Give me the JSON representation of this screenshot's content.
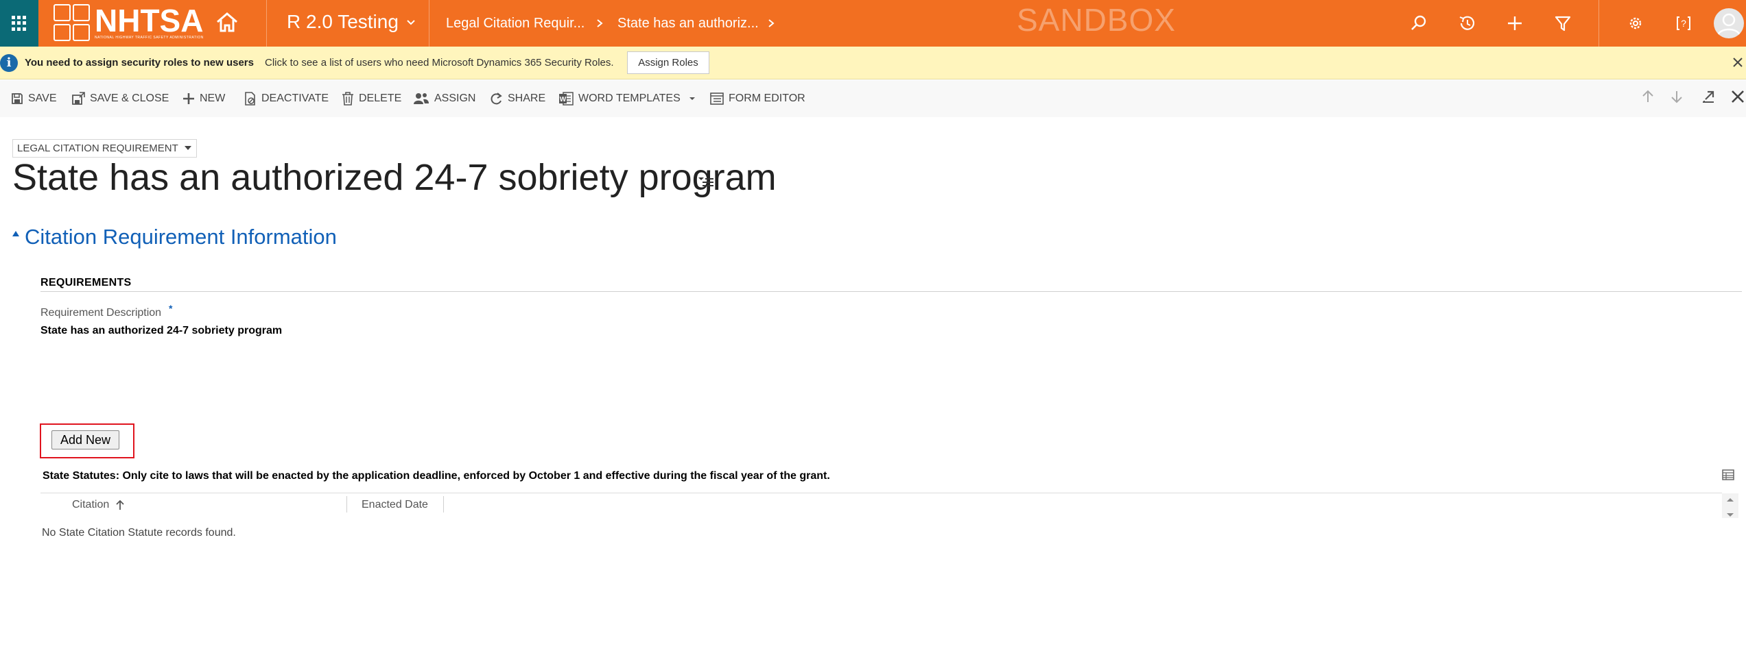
{
  "colors": {
    "nav_bar": "#f26f21",
    "waffle": "#0b6a76",
    "notification": "#fff5bd",
    "section_title": "#1160b7",
    "highlight": "#e0141e"
  },
  "nav": {
    "logo_text": "NHTSA",
    "logo_subtitle": "NATIONAL HIGHWAY TRAFFIC SAFETY ADMINISTRATION",
    "app_name": "R 2.0 Testing",
    "breadcrumbs": [
      "Legal Citation Requir...",
      "State has an authoriz..."
    ],
    "environment_banner": "SANDBOX",
    "icons": [
      "app-launcher-icon",
      "home-icon",
      "search-icon",
      "recent-icon",
      "plus-icon",
      "filter-icon",
      "gear-icon",
      "help-icon",
      "avatar"
    ]
  },
  "notification": {
    "title": "You need to assign security roles to new users",
    "message": "Click to see a list of users who need Microsoft Dynamics 365 Security Roles.",
    "action_label": "Assign Roles"
  },
  "commands": {
    "save": "SAVE",
    "save_close": "SAVE & CLOSE",
    "new": "NEW",
    "deactivate": "DEACTIVATE",
    "delete": "DELETE",
    "assign": "ASSIGN",
    "share": "SHARE",
    "word_templates": "WORD TEMPLATES",
    "form_editor": "FORM EDITOR"
  },
  "form": {
    "entity_label": "LEGAL CITATION REQUIREMENT",
    "record_title": "State has an authorized 24-7 sobriety program",
    "section_title": "Citation Requirement Information",
    "requirements_heading": "REQUIREMENTS",
    "requirement_label": "Requirement Description",
    "required_marker": "*",
    "requirement_value": "State has an authorized 24-7 sobriety program",
    "add_new_label": "Add New",
    "statutes_heading": "State Statutes: Only cite to laws that will be enacted by the application deadline, enforced by October 1 and effective during the fiscal year of the grant.",
    "columns": [
      "Citation",
      "Enacted Date"
    ],
    "empty_message": "No State Citation Statute records found."
  }
}
